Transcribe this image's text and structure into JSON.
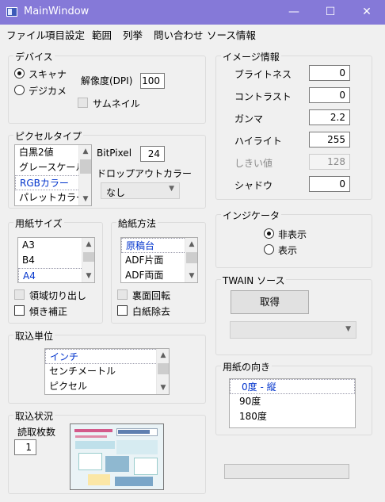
{
  "window": {
    "title": "MainWindow",
    "minimize": "—",
    "maximize": "☐",
    "close": "✕"
  },
  "menu": [
    "ファイル",
    "項目設定",
    "範囲",
    "列挙",
    "問い合わせ",
    "ソース情報"
  ],
  "device": {
    "title": "デバイス",
    "scanner": "スキャナ",
    "camera": "デジカメ",
    "resolution_label": "解像度(DPI)",
    "resolution": "100",
    "thumbnail": "サムネイル"
  },
  "pixel": {
    "title": "ピクセルタイプ",
    "items": [
      "白黒2値",
      "グレースケール",
      "RGBカラー",
      "パレットカラー"
    ],
    "bitpixel_label": "BitPixel",
    "bitpixel": "24",
    "dropout_label": "ドロップアウトカラー",
    "dropout_value": "なし"
  },
  "paper": {
    "title": "用紙サイズ",
    "items": [
      "A3",
      "B4",
      "A4"
    ],
    "crop": "領域切り出し",
    "deskew": "傾き補正"
  },
  "feed": {
    "title": "給紙方法",
    "items": [
      "原稿台",
      "ADF片面",
      "ADF両面"
    ],
    "rotate_back": "裏面回転",
    "skip_blank": "白紙除去"
  },
  "unit": {
    "title": "取込単位",
    "items": [
      "インチ",
      "センチメートル",
      "ピクセル"
    ]
  },
  "capture": {
    "title": "取込状況",
    "count_label": "読取枚数",
    "count": "1"
  },
  "image": {
    "title": "イメージ情報",
    "rows": [
      {
        "label": "ブライトネス",
        "value": "0"
      },
      {
        "label": "コントラスト",
        "value": "0"
      },
      {
        "label": "ガンマ",
        "value": "2.2"
      },
      {
        "label": "ハイライト",
        "value": "255"
      },
      {
        "label": "しきい値",
        "value": "128"
      },
      {
        "label": "シャドウ",
        "value": "0"
      }
    ]
  },
  "indicator": {
    "title": "インジケータ",
    "hide": "非表示",
    "show": "表示"
  },
  "twain": {
    "title": "TWAIN ソース",
    "acquire": "取得",
    "source_value": ""
  },
  "orientation": {
    "title": "用紙の向き",
    "items": [
      "0度 - 縦",
      "90度",
      "180度"
    ]
  },
  "colors": {
    "titlebar": "#8579d8",
    "selected_text": "#0033cc"
  }
}
